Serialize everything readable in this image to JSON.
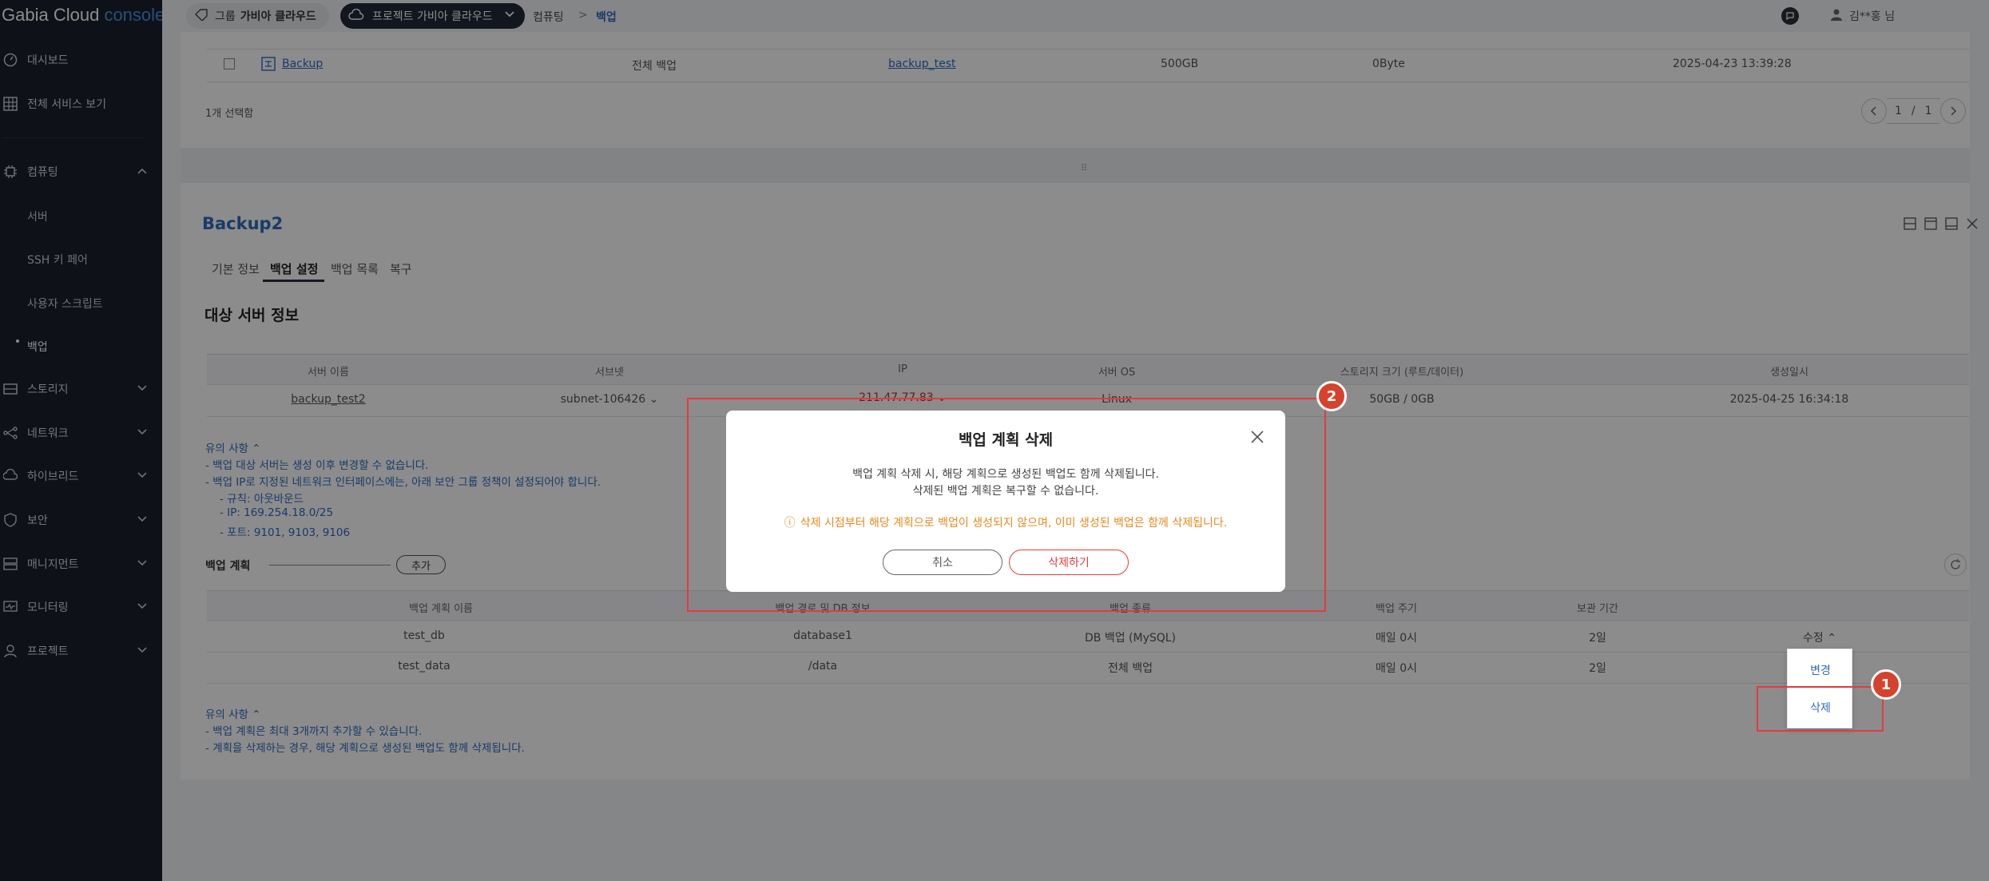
{
  "logo": {
    "brand": "Gabia Cloud",
    "suffix": "console"
  },
  "sidebar": {
    "top_items": [
      {
        "label": "대시보드",
        "icon": "dashboard-icon"
      },
      {
        "label": "전체 서비스 보기",
        "icon": "grid-icon"
      }
    ],
    "computing": {
      "label": "컴퓨팅",
      "subitems": [
        "서버",
        "SSH 키 페어",
        "사용자 스크립트",
        "백업"
      ]
    },
    "groups": [
      {
        "label": "스토리지"
      },
      {
        "label": "네트워크"
      },
      {
        "label": "하이브리드"
      },
      {
        "label": "보안"
      },
      {
        "label": "매니지먼트"
      },
      {
        "label": "모니터링"
      },
      {
        "label": "프로젝트"
      }
    ]
  },
  "topbar": {
    "group_prefix": "그룹",
    "group_name": "가비아 클라우드",
    "project_name": "프로젝트 가비아 클라우드",
    "breadcrumb_parent": "컴퓨팅",
    "breadcrumb_sep": ">",
    "breadcrumb_current": "백업",
    "user": "김**홍 님"
  },
  "top_table": {
    "row": {
      "name": "Backup",
      "type": "전체 백업",
      "server": "backup_test",
      "size": "500GB",
      "used": "0Byte",
      "date": "2025-04-23 13:39:28"
    },
    "selected_count": "1개 선택함",
    "pager": {
      "current": "1",
      "sep": "/",
      "total": "1"
    }
  },
  "detail": {
    "title": "Backup2",
    "tabs": [
      "기본 정보",
      "백업 설정",
      "백업 목록",
      "복구"
    ],
    "section_title": "대상 서버 정보",
    "server_table": {
      "headers": [
        "서버 이름",
        "서브넷",
        "IP",
        "서버 OS",
        "스토리지 크기 (루트/데이터)",
        "생성일시"
      ],
      "row": {
        "name": "backup_test2",
        "subnet": "subnet-106426",
        "ip": "211.47.77.83",
        "os": "Linux",
        "storage": "50GB / 0GB",
        "created": "2025-04-25 16:34:18"
      }
    },
    "notes1": {
      "title": "유의 사항",
      "lines": [
        "- 백업 대상 서버는 생성 이후 변경할 수 없습니다.",
        "- 백업 IP로 지정된 네트워크 인터페이스에는, 아래 보안 그룹 정책이 설정되어야 합니다.",
        "- 규칙: 아웃바운드",
        "- IP: 169.254.18.0/25",
        "- 포트: 9101, 9103, 9106"
      ]
    },
    "plan": {
      "label": "백업 계획",
      "add_button": "추가",
      "headers": [
        "백업 계획 이름",
        "백업 경로 및 DB 정보",
        "백업 종류",
        "백업 주기",
        "보관 기간"
      ],
      "rows": [
        {
          "name": "test_db",
          "path": "database1",
          "kind": "DB 백업 (MySQL)",
          "cycle": "매일 0시",
          "keep": "2일",
          "action": "수정"
        },
        {
          "name": "test_data",
          "path": "/data",
          "kind": "전체 백업",
          "cycle": "매일 0시",
          "keep": "2일"
        }
      ],
      "dropdown": [
        "변경",
        "삭제"
      ]
    },
    "notes2": {
      "title": "유의 사항",
      "lines": [
        "- 백업 계획은 최대 3개까지 추가할 수 있습니다.",
        "- 계획을 삭제하는 경우, 해당 계획으로 생성된 백업도 함께 삭제됩니다."
      ]
    }
  },
  "modal": {
    "title": "백업 계획 삭제",
    "line1": "백업 계획 삭제 시, 해당 계획으로 생성된 백업도 함께 삭제됩니다.",
    "line2": "삭제된 백업 계획은 복구할 수 없습니다.",
    "warning": "삭제 시점부터 해당 계획으로 백업이 생성되지 않으며, 이미 생성된 백업은 함께 삭제됩니다.",
    "cancel": "취소",
    "confirm": "삭제하기"
  },
  "annotations": {
    "badge1": "1",
    "badge2": "2"
  },
  "colors": {
    "sidebar_bg": "#1a1f2c",
    "link_blue": "#2d6cc0",
    "warning": "#e8891c",
    "danger": "#e23c3c",
    "badge": "#d6422b"
  }
}
